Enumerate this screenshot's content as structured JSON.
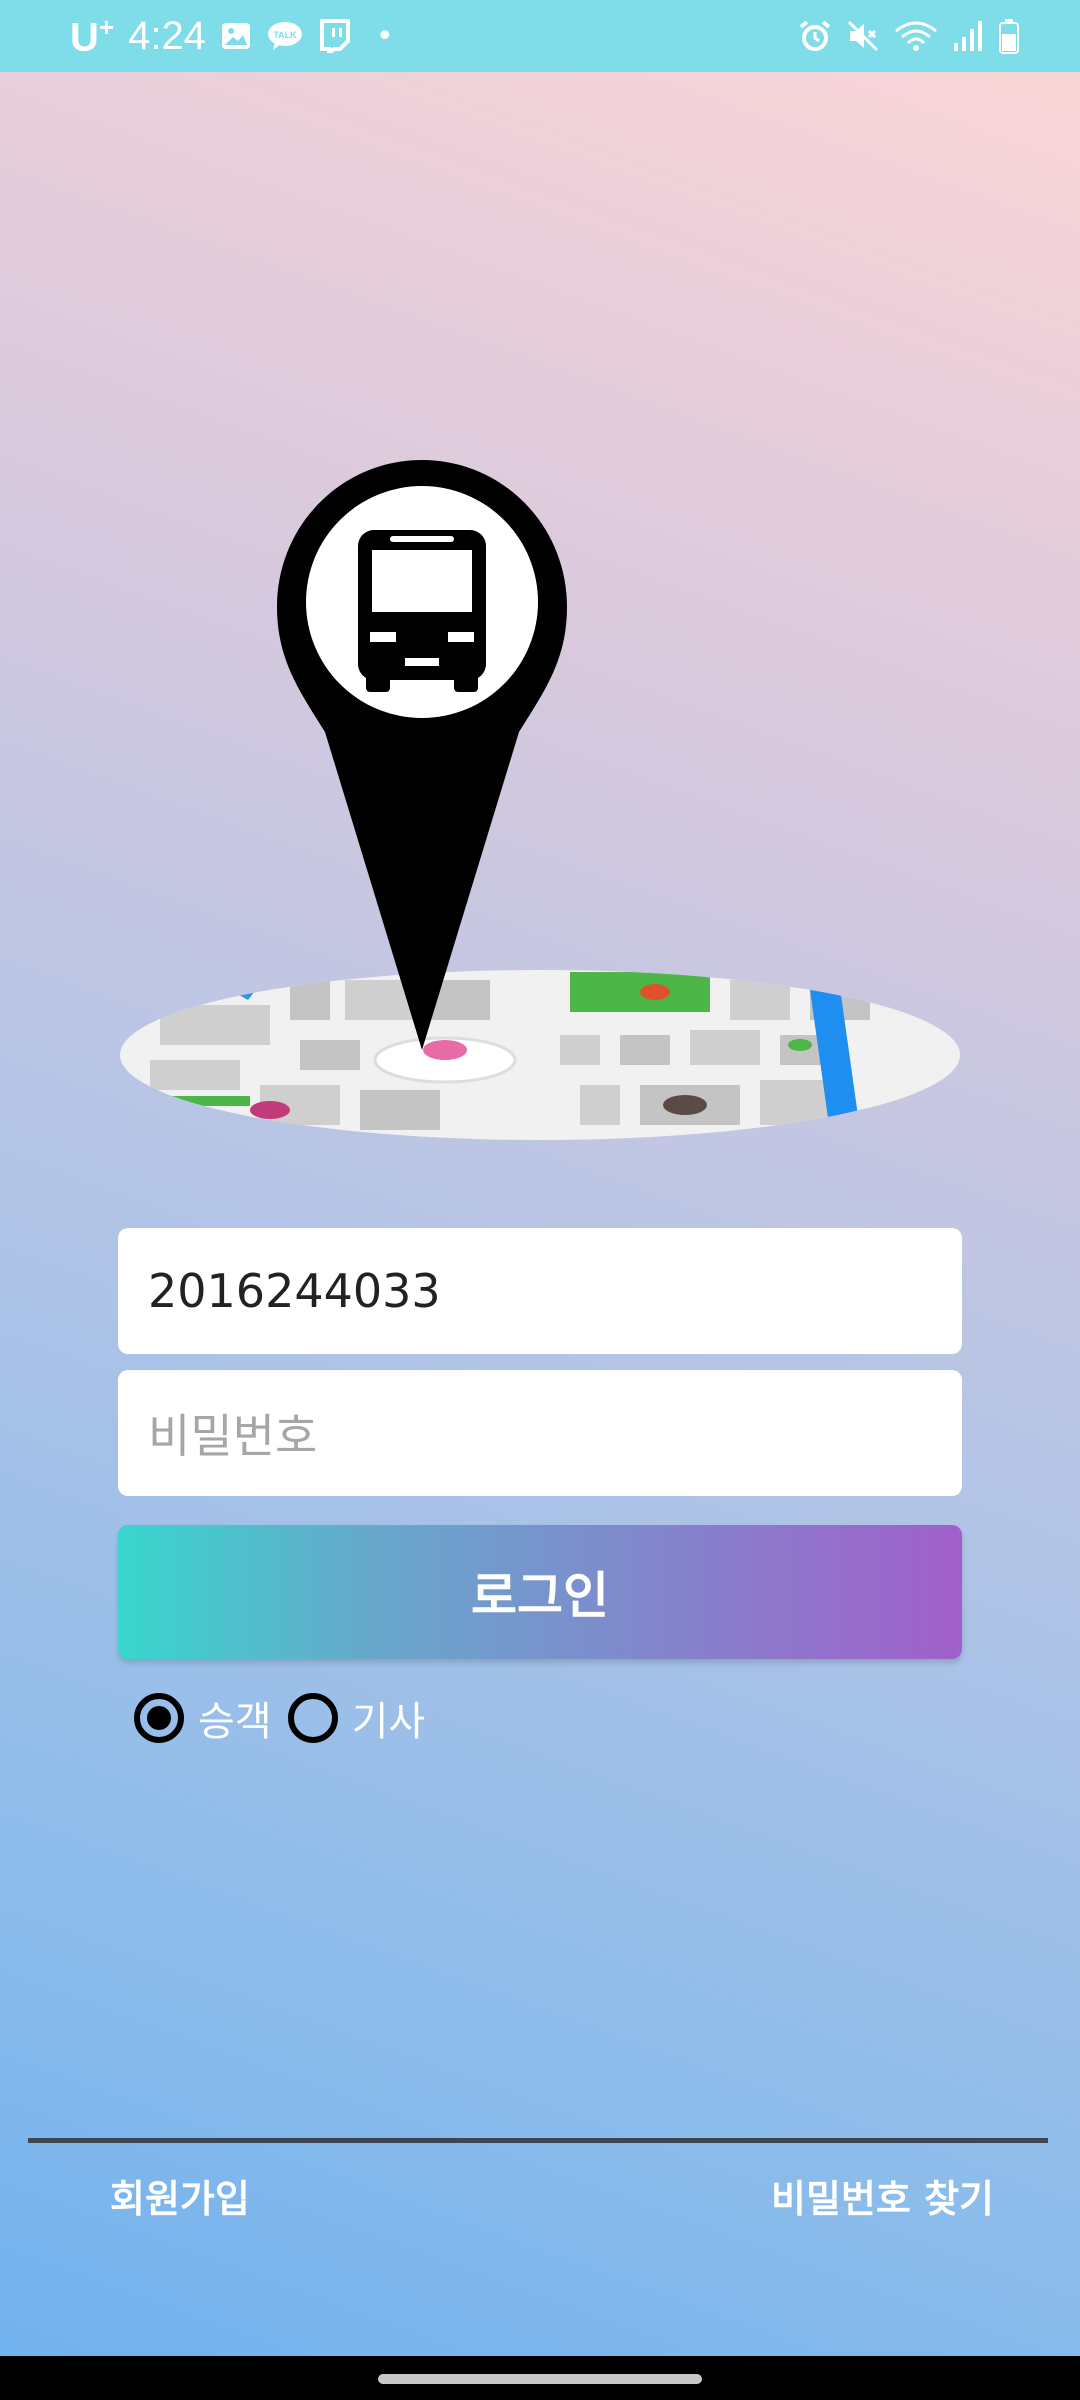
{
  "status_bar": {
    "carrier": "U",
    "carrier_sup": "+",
    "time": "4:24",
    "dot": "•"
  },
  "login": {
    "id_value": "2016244033",
    "password_placeholder": "비밀번호",
    "login_label": "로그인",
    "radio_options": [
      {
        "label": "승객",
        "selected": true
      },
      {
        "label": "기사",
        "selected": false
      }
    ]
  },
  "footer": {
    "signup_label": "회원가입",
    "find_password_label": "비밀번호 찾기"
  },
  "colors": {
    "status_bar": "#7fdde9",
    "button_start": "#38d6cc",
    "button_end": "#a15fcb"
  }
}
